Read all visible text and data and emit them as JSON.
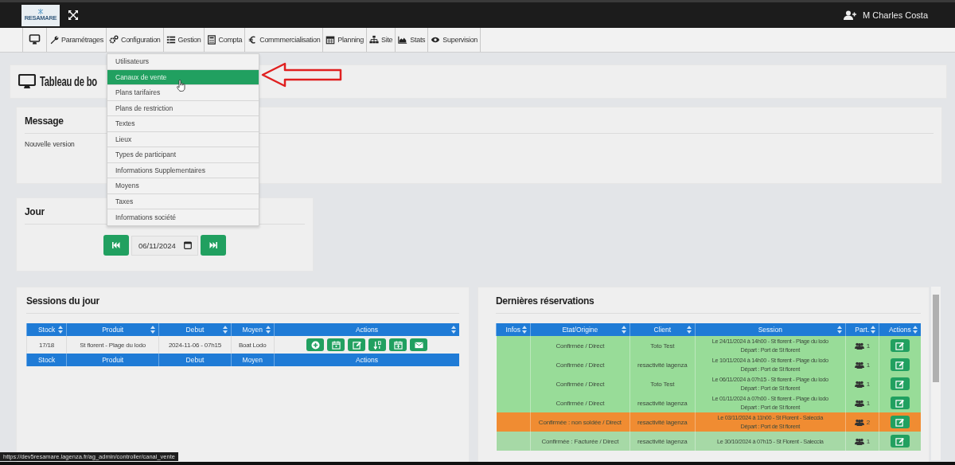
{
  "topbar": {
    "logo_text": "RESAMARE",
    "user": "M Charles Costa"
  },
  "nav": {
    "items": [
      {
        "kind": "monitor"
      },
      {
        "kind": "wrench",
        "label": "Paramétrages"
      },
      {
        "kind": "gears",
        "label": "Configuration"
      },
      {
        "kind": "list",
        "label": "Gestion"
      },
      {
        "kind": "calculator",
        "label": "Compta"
      },
      {
        "kind": "euro",
        "label": "Commmercialisation"
      },
      {
        "kind": "calendar",
        "label": "Planning"
      },
      {
        "kind": "sitemap",
        "label": "Site"
      },
      {
        "kind": "chart",
        "label": "Stats"
      },
      {
        "kind": "eye",
        "label": "Supervision"
      }
    ]
  },
  "dropdown": {
    "items": [
      {
        "label": "Utilisateurs",
        "selected": false
      },
      {
        "label": "Canaux de vente",
        "selected": true
      },
      {
        "label": "Plans tarifaires",
        "selected": false
      },
      {
        "label": "Plans de restriction",
        "selected": false
      },
      {
        "label": "Textes",
        "selected": false
      },
      {
        "label": "Lieux",
        "selected": false
      },
      {
        "label": "Types de participant",
        "selected": false
      },
      {
        "label": "Informations Supplementaires",
        "selected": false
      },
      {
        "label": "Moyens",
        "selected": false
      },
      {
        "label": "Taxes",
        "selected": false
      },
      {
        "label": "Informations société",
        "selected": false
      }
    ]
  },
  "page_title": "Tableau de bo",
  "message": {
    "title": "Message",
    "text": "Nouvelle version"
  },
  "jour": {
    "title": "Jour",
    "date": "06/11/2024"
  },
  "sessions": {
    "title": "Sessions du jour",
    "columns": [
      "Stock",
      "Produit",
      "Debut",
      "Moyen",
      "Actions"
    ],
    "rows": [
      {
        "cells": [
          "17/18",
          "St florent - Plage du lodo",
          "2024-11-06 - 07h15",
          "Boat Lodo"
        ],
        "actions": [
          {
            "kind": "plus"
          },
          {
            "kind": "calendar"
          },
          {
            "kind": "edit"
          },
          {
            "kind": "sort"
          },
          {
            "kind": "calendar-plus"
          },
          {
            "kind": "mail"
          }
        ]
      }
    ],
    "footer_columns": [
      "Stock",
      "Produit",
      "Debut",
      "Moyen",
      "Actions"
    ]
  },
  "reservations": {
    "title": "Dernières réservations",
    "columns": [
      "Infos",
      "Etat/Origine",
      "Client",
      "Session",
      "Part.",
      "Actions"
    ],
    "rows": [
      {
        "color": "#98dc98",
        "etat": "Confirmée / Direct",
        "client": "Toto Test",
        "session": [
          "Le 24/11/2024 à 14h00 - St florent - Plage du lodo",
          "Départ : Port de St florent"
        ],
        "part": "1"
      },
      {
        "color": "#98dc98",
        "etat": "Confirmée / Direct",
        "client": "resactivité lagenza",
        "session": [
          "Le 10/11/2024 à 14h00 - St florent - Plage du lodo",
          "Départ : Port de St florent"
        ],
        "part": "1"
      },
      {
        "color": "#98dc98",
        "etat": "Confirmée / Direct",
        "client": "Toto Test",
        "session": [
          "Le 06/11/2024 à 07h15 - St florent - Plage du lodo",
          "Départ : Port de St florent"
        ],
        "part": "1"
      },
      {
        "color": "#98dc98",
        "etat": "Confirmée / Direct",
        "client": "resactivité lagenza",
        "session": [
          "Le 01/11/2024 à 07h00 - St florent - Plage du lodo",
          "Départ : Port de St florent"
        ],
        "part": "1"
      },
      {
        "color": "#f08c32",
        "etat": "Confirmée : non soldée / Direct",
        "client": "resactivité lagenza",
        "session": [
          "Le 03/11/2024 à 11h00 - St Florent - Saleccia",
          "Départ : Port de St florent"
        ],
        "part": "2"
      },
      {
        "color": "#a6d9a6",
        "etat": "Confirmée : Facturée / Direct",
        "client": "resactivité lagenza",
        "session": [
          "Le 30/10/2024 à 07h15 - St Florent - Saleccia"
        ],
        "part": "1"
      }
    ]
  },
  "status_url": "https://dev5resamare.lagenza.fr/ag_admin/controller/canal_vente"
}
